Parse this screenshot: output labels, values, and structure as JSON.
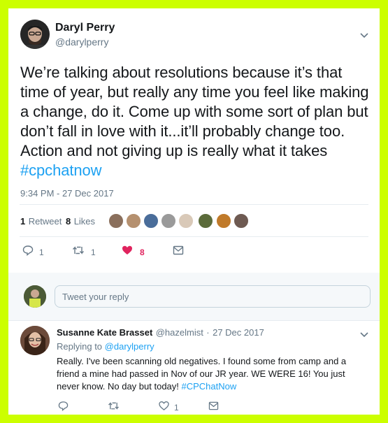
{
  "tweet": {
    "author_name": "Daryl Perry",
    "author_handle": "@darylperry",
    "text": "We’re talking about resolutions because it’s that time of  year, but really any time you feel like making a change, do it. Come up with some sort of plan but don’t fall in love with it...it’ll probably change too. Action and not giving up is really what it takes ",
    "hashtag": "#cpchatnow",
    "timestamp": "9:34 PM - 27 Dec 2017",
    "retweet_count": "1",
    "retweet_label": "Retweet",
    "like_count": "8",
    "like_label": "Likes",
    "actions": {
      "reply_count": "1",
      "retweet_count": "1",
      "like_count": "8"
    }
  },
  "reply_input": {
    "placeholder": "Tweet your reply"
  },
  "reply": {
    "author_name": "Susanne Kate Brasset",
    "author_handle": "@hazelmist",
    "dot": "·",
    "date": "27 Dec 2017",
    "replying_to_label": "Replying to",
    "replying_to_handle": "@darylperry",
    "text": "Really. I've been scanning old negatives. I found some from camp and a friend a mine had passed in Nov of our JR year. WE WERE 16! You just never know. No day but today! ",
    "hashtag": "#CPChatNow",
    "actions": {
      "like_count": "1"
    }
  },
  "colors": {
    "frame": "#ccff00",
    "accent": "#1da1f2",
    "like": "#e0245e",
    "muted": "#657786"
  },
  "icons": [
    "chevron-down-icon",
    "reply-icon",
    "retweet-icon",
    "heart-icon",
    "message-icon"
  ]
}
